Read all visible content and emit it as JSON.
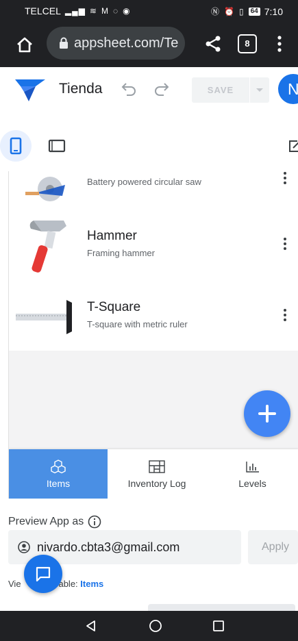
{
  "status_bar": {
    "carrier": "TELCEL",
    "left_icons": [
      "signal-icon",
      "wifi-icon",
      "gmail-icon",
      "whatsapp-icon",
      "chrome-icon"
    ],
    "right_icons": [
      "nfc-icon",
      "alarm-icon",
      "vibrate-icon"
    ],
    "battery": "64",
    "time": "7:10"
  },
  "browser": {
    "url": "appsheet.com/Te",
    "tab_count": "8"
  },
  "editor": {
    "app_name": "Tienda",
    "save_label": "SAVE",
    "avatar_initial": "N",
    "colors": {
      "brand_blue": "#1a73e8",
      "nav_active": "#4a8fe4",
      "fab": "#4285f4"
    }
  },
  "device_toolbar": {
    "modes": [
      "phone-icon",
      "tablet-icon"
    ],
    "selected": "phone"
  },
  "items": [
    {
      "title": "",
      "subtitle": "Battery powered circular saw",
      "icon": "circular-saw-icon"
    },
    {
      "title": "Hammer",
      "subtitle": "Framing hammer",
      "icon": "hammer-icon"
    },
    {
      "title": "T-Square",
      "subtitle": "T-square with metric ruler",
      "icon": "t-square-icon"
    }
  ],
  "bottom_nav": [
    {
      "label": "Items",
      "icon": "cubes-icon",
      "active": true
    },
    {
      "label": "Inventory Log",
      "icon": "table-icon",
      "active": false
    },
    {
      "label": "Levels",
      "icon": "bar-chart-icon",
      "active": false
    }
  ],
  "preview_as": {
    "label": "Preview App as",
    "email": "nivardo.cbta3@gmail.com",
    "apply_label": "Apply"
  },
  "view_info": {
    "view_prefix": "Vie",
    "view_name": "Items",
    "separator": "|",
    "table_label": "Table:",
    "table_name": "Items"
  }
}
